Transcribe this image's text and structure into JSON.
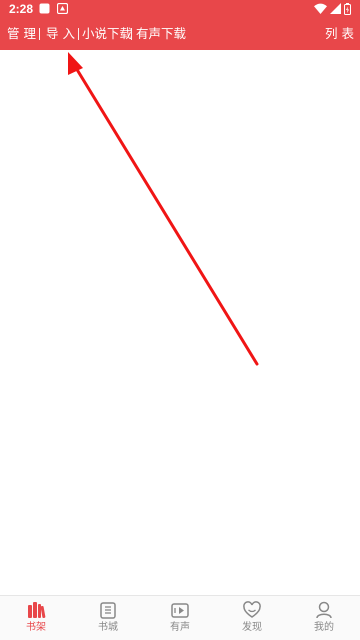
{
  "status_bar": {
    "time": "2:28",
    "notification_icons": [
      "app-notification-icon",
      "download-notification-icon"
    ],
    "system_icons": [
      "wifi-icon",
      "signal-icon",
      "battery-icon"
    ]
  },
  "toolbar": {
    "manage_label": "管 理",
    "import_label": "导 入",
    "local_download_label": "小说下载",
    "audio_download_label": "有声下载",
    "list_label": "列 表"
  },
  "annotation": {
    "color": "#f01515",
    "points_to": "toolbar.import_label"
  },
  "bottom_nav": {
    "items": [
      {
        "label": "书架",
        "icon": "bookshelf-icon",
        "active": true
      },
      {
        "label": "书城",
        "icon": "bookstore-icon",
        "active": false
      },
      {
        "label": "有声",
        "icon": "audio-icon",
        "active": false
      },
      {
        "label": "发现",
        "icon": "discover-icon",
        "active": false
      },
      {
        "label": "我的",
        "icon": "profile-icon",
        "active": false
      }
    ]
  },
  "colors": {
    "brand": "#e8474a",
    "nav_inactive": "#888888",
    "nav_active": "#e8474a"
  }
}
